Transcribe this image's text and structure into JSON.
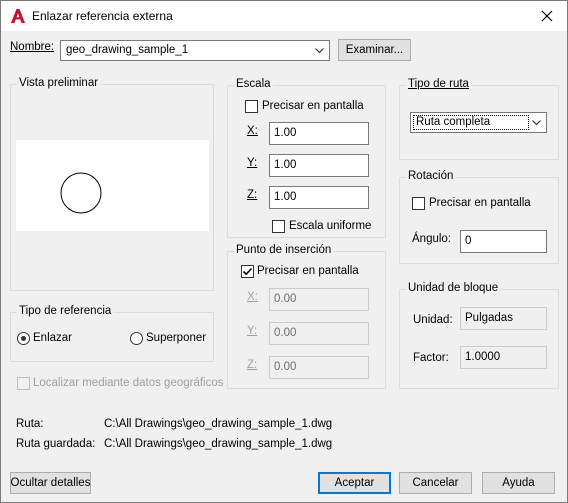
{
  "window": {
    "title": "Enlazar referencia externa"
  },
  "name_row": {
    "label": "Nombre:",
    "value": "geo_drawing_sample_1",
    "browse_label": "Examinar..."
  },
  "preview": {
    "title": "Vista preliminar"
  },
  "reference_type": {
    "title": "Tipo de referencia",
    "options": [
      {
        "label": "Enlazar",
        "selected": true
      },
      {
        "label": "Superponer",
        "selected": false
      }
    ]
  },
  "geo_locate": {
    "label": "Localizar mediante datos geográficos",
    "checked": false,
    "enabled": false
  },
  "scale": {
    "title": "Escala",
    "specify_label": "Precisar en pantalla",
    "specify_checked": false,
    "x_label": "X:",
    "x_value": "1.00",
    "y_label": "Y:",
    "y_value": "1.00",
    "z_label": "Z:",
    "z_value": "1.00",
    "uniform_label": "Escala uniforme",
    "uniform_checked": false
  },
  "insertion": {
    "title": "Punto de inserción",
    "specify_label": "Precisar en pantalla",
    "specify_checked": true,
    "x_label": "X:",
    "x_value": "0.00",
    "y_label": "Y:",
    "y_value": "0.00",
    "z_label": "Z:",
    "z_value": "0.00"
  },
  "path_type": {
    "title": "Tipo de ruta",
    "value": "Ruta completa"
  },
  "rotation": {
    "title": "Rotación",
    "specify_label": "Precisar en pantalla",
    "specify_checked": false,
    "angle_label": "Ángulo:",
    "angle_value": "0"
  },
  "block_unit": {
    "title": "Unidad de bloque",
    "unit_label": "Unidad:",
    "unit_value": "Pulgadas",
    "factor_label": "Factor:",
    "factor_value": "1.0000"
  },
  "paths": {
    "path_label": "Ruta:",
    "path_value": "C:\\All Drawings\\geo_drawing_sample_1.dwg",
    "saved_label": "Ruta guardada:",
    "saved_value": "C:\\All Drawings\\geo_drawing_sample_1.dwg"
  },
  "footer": {
    "hide_details": "Ocultar detalles",
    "ok": "Aceptar",
    "cancel": "Cancelar",
    "help": "Ayuda"
  },
  "colors": {
    "accent": "#0078d7",
    "app_icon": "#c8102e"
  }
}
